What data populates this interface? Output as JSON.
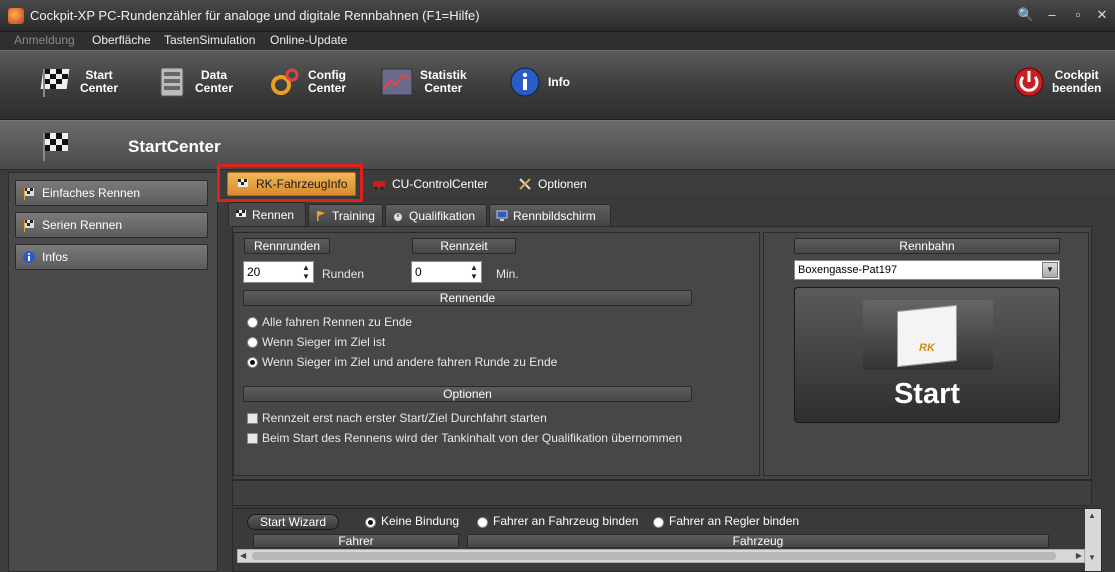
{
  "window": {
    "title": "Cockpit-XP PC-Rundenzähler für analoge und digitale Rennbahnen (F1=Hilfe)"
  },
  "menu": {
    "items": [
      {
        "label": "Anmeldung",
        "disabled": true
      },
      {
        "label": "Oberfläche",
        "disabled": false
      },
      {
        "label": "TastenSimulation",
        "disabled": false
      },
      {
        "label": "Online-Update",
        "disabled": false
      }
    ]
  },
  "toolbar": {
    "start_center": "Start\nCenter",
    "data_center": "Data\nCenter",
    "config_center": "Config\nCenter",
    "statistik_center": "Statistik\nCenter",
    "info": "Info",
    "cockpit_beenden": "Cockpit\nbeenden"
  },
  "section": {
    "title": "StartCenter"
  },
  "sidebar": {
    "items": [
      {
        "label": "Einfaches Rennen",
        "icon": "flags-icon"
      },
      {
        "label": "Serien Rennen",
        "icon": "flags-icon"
      },
      {
        "label": "Infos",
        "icon": "info-icon"
      }
    ]
  },
  "top_tabs": {
    "items": [
      {
        "label": "RK-FahrzeugInfo",
        "active": true
      },
      {
        "label": "CU-ControlCenter",
        "active": false
      },
      {
        "label": "Optionen",
        "active": false
      }
    ]
  },
  "sub_tabs": {
    "items": [
      {
        "label": "Rennen",
        "active": true
      },
      {
        "label": "Training",
        "active": false
      },
      {
        "label": "Qualifikation",
        "active": false
      },
      {
        "label": "Rennbildschirm",
        "active": false
      }
    ]
  },
  "race": {
    "rennrunden_header": "Rennrunden",
    "rennrunden_value": "20",
    "runden_unit": "Runden",
    "rennzeit_header": "Rennzeit",
    "rennzeit_value": "0",
    "min_unit": "Min.",
    "rennende_header": "Rennende",
    "rennende_options": [
      {
        "label": "Alle fahren Rennen zu Ende",
        "checked": false
      },
      {
        "label": "Wenn Sieger im Ziel ist",
        "checked": false
      },
      {
        "label": "Wenn Sieger im Ziel und andere fahren Runde zu Ende",
        "checked": true
      }
    ],
    "optionen_header": "Optionen",
    "optionen_checks": [
      {
        "label": "Rennzeit erst nach erster Start/Ziel Durchfahrt starten",
        "checked": false
      },
      {
        "label": "Beim Start des Rennens wird der Tankinhalt von der Qualifikation übernommen",
        "checked": false
      }
    ]
  },
  "track": {
    "header": "Rennbahn",
    "selected": "Boxengasse-Pat197",
    "start_label": "Start",
    "art_label": "RK"
  },
  "wizard": {
    "button": "Start Wizard",
    "options": [
      {
        "label": "Keine Bindung",
        "checked": true
      },
      {
        "label": "Fahrer an Fahrzeug binden",
        "checked": false
      },
      {
        "label": "Fahrer an Regler binden",
        "checked": false
      }
    ],
    "columns": [
      "Fahrer",
      "Fahrzeug"
    ]
  },
  "colors": {
    "highlight": "#e0201c",
    "active_tab": "#e8a040",
    "background": "#3c3c3c"
  }
}
